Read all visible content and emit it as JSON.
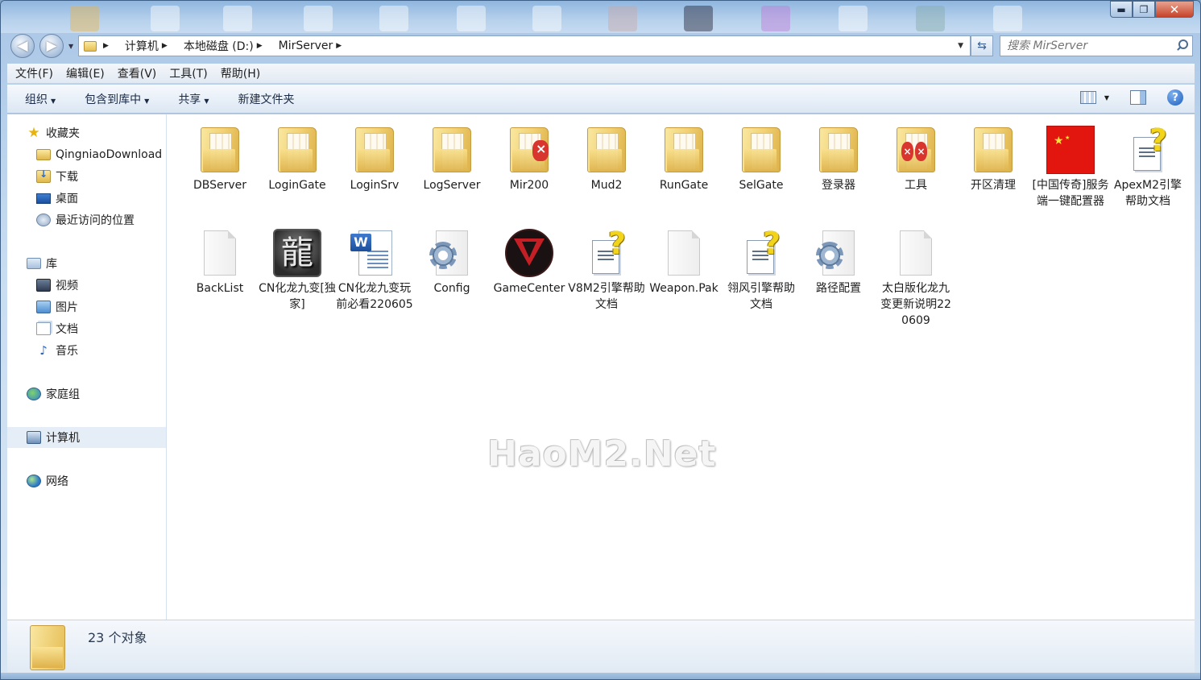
{
  "window": {
    "controls": {
      "minimize": "▬",
      "maximize": "❐",
      "close": "✕"
    }
  },
  "address": {
    "segments": [
      "计算机",
      "本地磁盘 (D:)",
      "MirServer"
    ],
    "search_placeholder": "搜索 MirServer"
  },
  "menubar": {
    "items": [
      "文件(F)",
      "编辑(E)",
      "查看(V)",
      "工具(T)",
      "帮助(H)"
    ]
  },
  "toolbar": {
    "organize": "组织",
    "include_in_library": "包含到库中",
    "share": "共享",
    "new_folder": "新建文件夹"
  },
  "nav": {
    "favorites": {
      "label": "收藏夹",
      "items": [
        "QingniaoDownload",
        "下载",
        "桌面",
        "最近访问的位置"
      ]
    },
    "libraries": {
      "label": "库",
      "items": [
        "视频",
        "图片",
        "文档",
        "音乐"
      ]
    },
    "homegroup": "家庭组",
    "computer": "计算机",
    "network": "网络"
  },
  "files": [
    {
      "name": "DBServer",
      "icon": "folder-icon"
    },
    {
      "name": "LoginGate",
      "icon": "folder-icon"
    },
    {
      "name": "LoginSrv",
      "icon": "folder-icon"
    },
    {
      "name": "LogServer",
      "icon": "folder-icon"
    },
    {
      "name": "Mir200",
      "icon": "folder-badge-icon"
    },
    {
      "name": "Mud2",
      "icon": "folder-icon"
    },
    {
      "name": "RunGate",
      "icon": "folder-icon"
    },
    {
      "name": "SelGate",
      "icon": "folder-icon"
    },
    {
      "name": "登录器",
      "icon": "folder-icon"
    },
    {
      "name": "工具",
      "icon": "folder-badge-icon"
    },
    {
      "name": "开区清理",
      "icon": "folder-icon"
    },
    {
      "name": "[中国传奇]服务端一键配置器",
      "icon": "china-flag-icon"
    },
    {
      "name": "ApexM2引擎帮助文档",
      "icon": "help-doc-icon"
    },
    {
      "name": "BackList",
      "icon": "blank-file-icon"
    },
    {
      "name": "CN化龙九变[独家]",
      "icon": "dragon-app-icon"
    },
    {
      "name": "CN化龙九变玩前必看220605",
      "icon": "word-doc-icon"
    },
    {
      "name": "Config",
      "icon": "config-file-icon"
    },
    {
      "name": "GameCenter",
      "icon": "v-logo-icon"
    },
    {
      "name": "V8M2引擎帮助文档",
      "icon": "help-doc-icon"
    },
    {
      "name": "Weapon.Pak",
      "icon": "blank-file-icon"
    },
    {
      "name": "翎风引擎帮助文档",
      "icon": "help-doc-icon"
    },
    {
      "name": "路径配置",
      "icon": "config-file-icon"
    },
    {
      "name": "太白版化龙九变更新说明220609",
      "icon": "blank-file-icon"
    }
  ],
  "watermark": "HaoM2.Net",
  "status": {
    "count": "23 个对象"
  },
  "colors": {
    "titlebar": "#a9c6e6",
    "selection": "#e5edf7",
    "close": "#c7432a"
  }
}
